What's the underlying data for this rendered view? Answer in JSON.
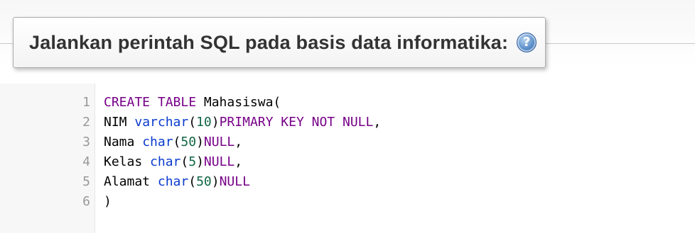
{
  "header": {
    "title": "Jalankan perintah SQL pada basis data informatika:",
    "help_icon": "help-icon",
    "help_glyph": "?"
  },
  "editor": {
    "lines": [
      {
        "number": "1",
        "tokens": [
          {
            "t": "CREATE TABLE",
            "k": "kw"
          },
          {
            "t": " Mahasiswa(",
            "k": "pl"
          }
        ]
      },
      {
        "number": "2",
        "tokens": [
          {
            "t": "NIM ",
            "k": "pl"
          },
          {
            "t": "varchar",
            "k": "ty"
          },
          {
            "t": "(",
            "k": "pl"
          },
          {
            "t": "10",
            "k": "nm"
          },
          {
            "t": ")",
            "k": "pl"
          },
          {
            "t": "PRIMARY KEY NOT NULL",
            "k": "kw"
          },
          {
            "t": ",",
            "k": "pl"
          }
        ]
      },
      {
        "number": "3",
        "tokens": [
          {
            "t": "Nama ",
            "k": "pl"
          },
          {
            "t": "char",
            "k": "ty"
          },
          {
            "t": "(",
            "k": "pl"
          },
          {
            "t": "50",
            "k": "nm"
          },
          {
            "t": ")",
            "k": "pl"
          },
          {
            "t": "NULL",
            "k": "kw"
          },
          {
            "t": ",",
            "k": "pl"
          }
        ]
      },
      {
        "number": "4",
        "tokens": [
          {
            "t": "Kelas ",
            "k": "pl"
          },
          {
            "t": "char",
            "k": "ty"
          },
          {
            "t": "(",
            "k": "pl"
          },
          {
            "t": "5",
            "k": "nm"
          },
          {
            "t": ")",
            "k": "pl"
          },
          {
            "t": "NULL",
            "k": "kw"
          },
          {
            "t": ",",
            "k": "pl"
          }
        ]
      },
      {
        "number": "5",
        "tokens": [
          {
            "t": "Alamat ",
            "k": "pl"
          },
          {
            "t": "char",
            "k": "ty"
          },
          {
            "t": "(",
            "k": "pl"
          },
          {
            "t": "50",
            "k": "nm"
          },
          {
            "t": ")",
            "k": "pl"
          },
          {
            "t": "NULL",
            "k": "kw"
          }
        ]
      },
      {
        "number": "6",
        "tokens": [
          {
            "t": ")",
            "k": "pl"
          }
        ]
      }
    ]
  },
  "colors": {
    "keyword": "#770088",
    "type": "#0a3bcd",
    "number": "#116644",
    "line_number": "#999999"
  }
}
